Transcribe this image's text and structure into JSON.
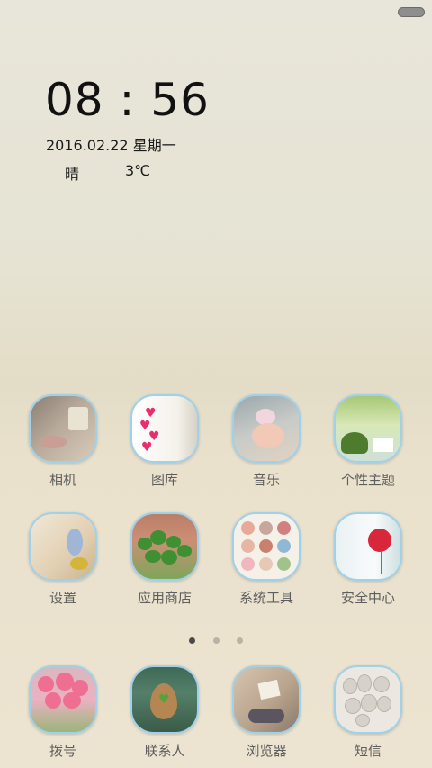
{
  "status": {
    "indicator_icon": "battery-pill-icon"
  },
  "clock": {
    "time": "08 : 56"
  },
  "date": {
    "text": "2016.02.22  星期一"
  },
  "weather": {
    "desc": "晴",
    "temp": "3℃"
  },
  "apps": {
    "camera": {
      "label": "相机",
      "icon": "camera-icon"
    },
    "gallery": {
      "label": "图库",
      "icon": "gallery-icon"
    },
    "music": {
      "label": "音乐",
      "icon": "music-icon"
    },
    "themes": {
      "label": "个性主题",
      "icon": "themes-icon"
    },
    "settings": {
      "label": "设置",
      "icon": "settings-icon"
    },
    "store": {
      "label": "应用商店",
      "icon": "app-store-icon"
    },
    "tools": {
      "label": "系统工具",
      "icon": "system-tools-folder-icon"
    },
    "security": {
      "label": "安全中心",
      "icon": "security-center-icon"
    }
  },
  "page_indicator": {
    "count": 3,
    "active": 1
  },
  "dock": {
    "dialer": {
      "label": "拨号",
      "icon": "phone-icon"
    },
    "contacts": {
      "label": "联系人",
      "icon": "contacts-icon"
    },
    "browser": {
      "label": "浏览器",
      "icon": "browser-icon"
    },
    "sms": {
      "label": "短信",
      "icon": "messages-icon"
    }
  },
  "colors": {
    "icon_border": "#9fd1ea",
    "label": "#5e5e5e",
    "clock": "#111111"
  }
}
